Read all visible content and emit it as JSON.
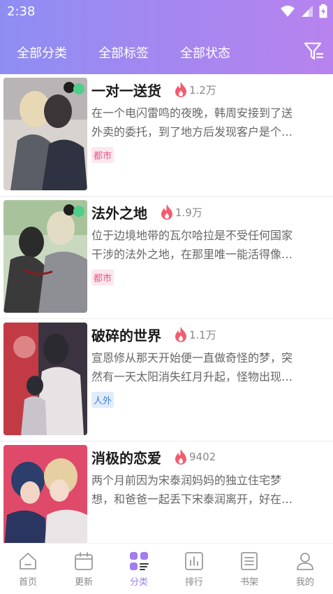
{
  "status": {
    "time": "2:38"
  },
  "filters": {
    "category": "全部分类",
    "tags": "全部标签",
    "status": "全部状态"
  },
  "colors": {
    "accent": "#a07ef0",
    "heat": "#f25c6e",
    "header_start": "#8e8ef2",
    "header_end": "#b883ee"
  },
  "books": [
    {
      "title": "一对一送货",
      "heat": "1.2万",
      "desc_line1": "在一个电闪雷鸣的夜晚，韩周安接到了送",
      "desc_line2": "外卖的委托，到了地方后发现客户是个…",
      "tag": "都市",
      "tag_style": "pink"
    },
    {
      "title": "法外之地",
      "heat": "1.9万",
      "desc_line1": "位于边境地带的瓦尔哈拉是不受任何国家",
      "desc_line2": "干涉的法外之地，在那里唯一能活得像…",
      "tag": "都市",
      "tag_style": "pink"
    },
    {
      "title": "破碎的世界",
      "heat": "1.1万",
      "desc_line1": "宣恩修从那天开始便一直做奇怪的梦，突",
      "desc_line2": "然有一天太阳消失红月升起，怪物出现…",
      "tag": "人外",
      "tag_style": "blue"
    },
    {
      "title": "消极的恋爱",
      "heat": "9402",
      "desc_line1": "两个月前因为宋泰润妈妈的独立住宅梦",
      "desc_line2": "想，和爸爸一起丢下宋泰润离开，好在…"
    }
  ],
  "nav": [
    {
      "label": "首页",
      "icon": "home-icon"
    },
    {
      "label": "更新",
      "icon": "calendar-icon"
    },
    {
      "label": "分类",
      "icon": "category-icon",
      "active": true
    },
    {
      "label": "排行",
      "icon": "ranking-icon"
    },
    {
      "label": "书架",
      "icon": "bookshelf-icon"
    },
    {
      "label": "我的",
      "icon": "profile-icon"
    }
  ]
}
